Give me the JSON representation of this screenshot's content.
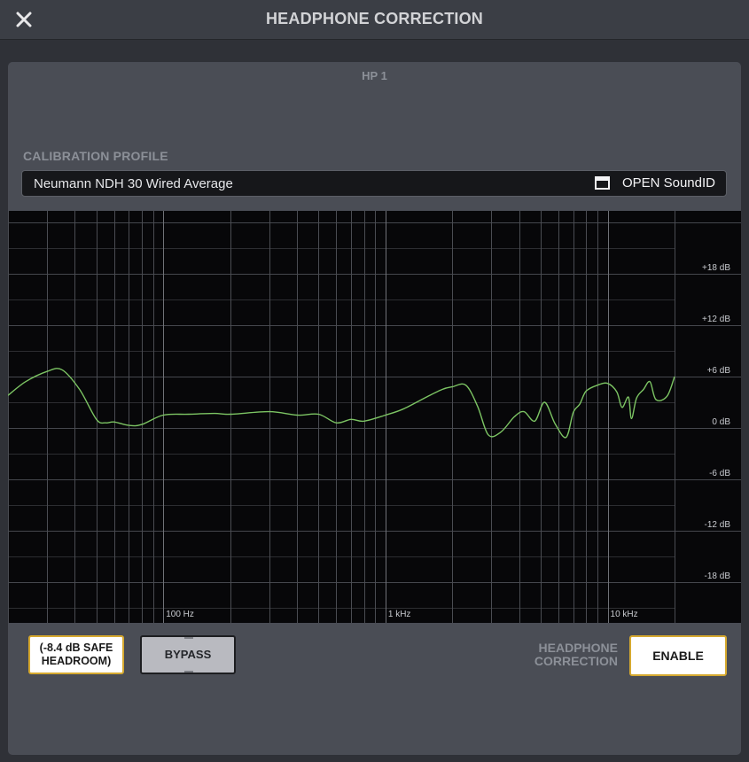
{
  "window": {
    "title": "HEADPHONE CORRECTION",
    "close_icon": "close-icon"
  },
  "panel": {
    "output_label": "HP 1",
    "calibration_label": "CALIBRATION PROFILE",
    "profile_name": "Neumann NDH 30 Wired Average",
    "open_button": {
      "icon": "window-icon",
      "label": "OPEN SoundID"
    }
  },
  "graph": {
    "curve_color": "#7cc463",
    "freq_labels": [
      "100 Hz",
      "1 kHz",
      "10 kHz"
    ],
    "db_labels": [
      "+18 dB",
      "+12 dB",
      "+6 dB",
      "0 dB",
      "-6 dB",
      "-12 dB",
      "-18 dB"
    ]
  },
  "chart_data": {
    "type": "line",
    "xscale": "log",
    "xlim": [
      20,
      20000
    ],
    "ylim": [
      -20,
      20
    ],
    "grid": true,
    "x_ticks": [
      "100 Hz",
      "1 kHz",
      "10 kHz"
    ],
    "y_ticks": [
      "+18 dB",
      "+12 dB",
      "+6 dB",
      "0 dB",
      "-6 dB",
      "-12 dB",
      "-18 dB"
    ],
    "series": [
      {
        "x": [
          20,
          24,
          30,
          35,
          42,
          50,
          55,
          60,
          70,
          80,
          100,
          130,
          170,
          200,
          300,
          400,
          500,
          600,
          700,
          800,
          1000,
          1200,
          1500,
          1800,
          2000,
          2300,
          2600,
          2900,
          3300,
          3800,
          4200,
          4700,
          5200,
          5800,
          6500,
          7000,
          7500,
          8000,
          9000,
          10000,
          11000,
          11600,
          12400,
          12800,
          13500,
          14500,
          15500,
          16500,
          18500,
          20000
        ],
        "y": [
          3.8,
          5.4,
          6.6,
          6.8,
          4.5,
          1.0,
          0.6,
          0.7,
          0.3,
          0.4,
          1.5,
          1.6,
          1.7,
          1.6,
          1.9,
          1.5,
          1.6,
          0.6,
          1.0,
          0.8,
          1.5,
          2.2,
          3.5,
          4.5,
          4.8,
          5.0,
          2.5,
          -0.8,
          -0.5,
          1.3,
          1.9,
          0.8,
          3.0,
          0.5,
          -1.1,
          1.8,
          2.8,
          4.3,
          5.0,
          5.2,
          4.2,
          2.4,
          3.6,
          1.1,
          3.5,
          4.5,
          5.4,
          3.3,
          3.7,
          6.0
        ]
      }
    ]
  },
  "controls": {
    "headroom_line1": "(-8.4 dB SAFE",
    "headroom_line2": "HEADROOM)",
    "bypass_label": "BYPASS",
    "hc_line1": "HEADPHONE",
    "hc_line2": "CORRECTION",
    "enable_label": "ENABLE"
  }
}
